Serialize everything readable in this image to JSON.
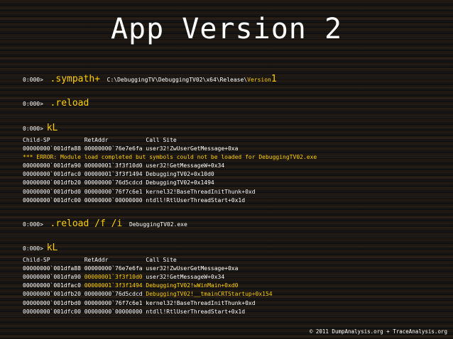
{
  "title": "App Version 2",
  "prompt": "0:000>",
  "cmd1": {
    "command": ".sympath+",
    "path_start": "C:\\DebuggingTV\\DebuggingTV02\\x64\\Release\\",
    "path_hl": "Version",
    "path_num": "1"
  },
  "cmd2": {
    "command": ".reload"
  },
  "cmd3": {
    "command": "kL"
  },
  "header": "Child-SP          RetAddr           Call Site",
  "stack1": [
    "00000000`001dfa88 00000000`76e7e6fa user32!ZwUserGetMessage+0xa",
    "*** ERROR: Module load completed but symbols could not be loaded for DebuggingTV02.exe",
    "00000000`001dfa90 00000001`3f3f10d0 user32!GetMessageW+0x34",
    "00000000`001dfac0 00000001`3f3f1494 DebuggingTV02+0x10d0",
    "00000000`001dfb20 00000000`76d5cdcd DebuggingTV02+0x1494",
    "00000000`001dfbd0 00000000`76f7c6e1 kernel32!BaseThreadInitThunk+0xd",
    "00000000`001dfc00 00000000`00000000 ntdll!RtlUserThreadStart+0x1d"
  ],
  "cmd4": {
    "command": ".reload /f /i",
    "arg": "DebuggingTV02.exe"
  },
  "cmd5": {
    "command": "kL"
  },
  "stack2": {
    "r1": "00000000`001dfa88 00000000`76e7e6fa user32!ZwUserGetMessage+0xa",
    "r2_a": "00000000`001dfa90 ",
    "r2_b": "00000001`3f3f10d0",
    "r2_c": " user32!GetMessageW+0x34",
    "r3_a": "00000000`001dfac0 ",
    "r3_b": "00000001`3f3f1494 DebuggingTV02!wWinMain+0xd0",
    "r4_a": "00000000`001dfb20 00000000`76d5cdcd ",
    "r4_b": "DebuggingTV02!__tmainCRTStartup+0x154",
    "r5": "00000000`001dfbd0 00000000`76f7c6e1 kernel32!BaseThreadInitThunk+0xd",
    "r6": "00000000`001dfc00 00000000`00000000 ntdll!RtlUserThreadStart+0x1d"
  },
  "footer": "© 2011 DumpAnalysis.org + TraceAnalysis.org",
  "colors": {
    "highlight": "#ffd000",
    "text": "#ffffff",
    "background": "#121212"
  }
}
